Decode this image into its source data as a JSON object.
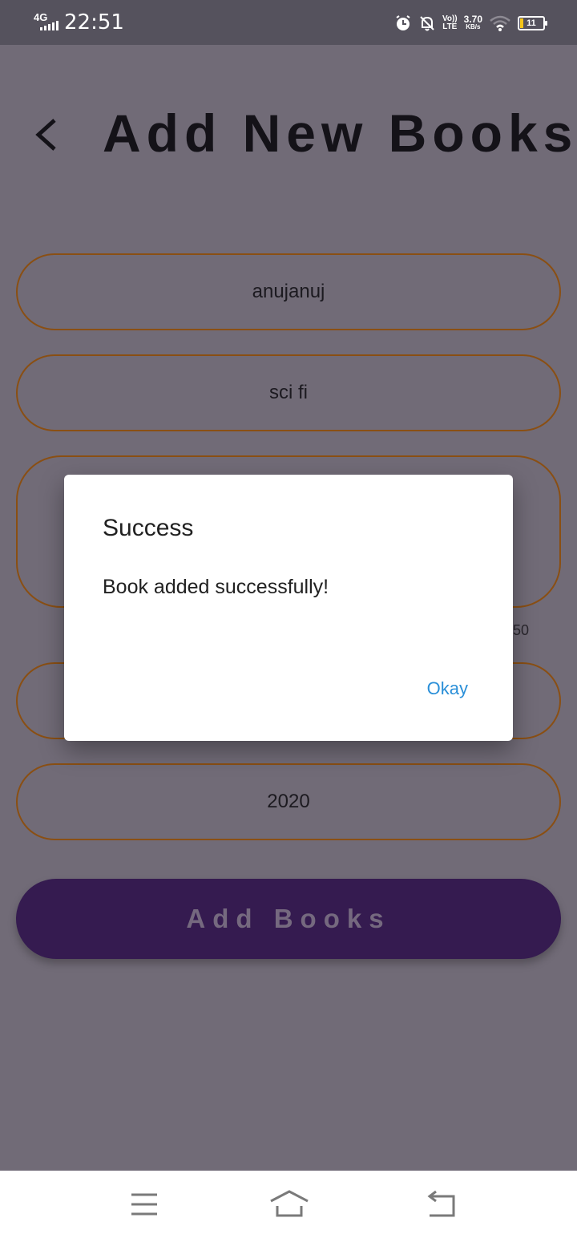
{
  "status_bar": {
    "network": "4G",
    "time": "22:51",
    "volte": "Vo))",
    "lte": "LTE",
    "speed_value": "3.70",
    "speed_unit": "KB/s",
    "battery": "11",
    "icons": [
      "signal-icon",
      "alarm-icon",
      "bell-off-icon",
      "wifi-icon",
      "battery-icon"
    ]
  },
  "header": {
    "title": "Add New Books",
    "back_icon": "chevron-left-icon"
  },
  "form": {
    "field1_value": "anujanuj",
    "field2_value": "sci fi",
    "field3_value": "",
    "counter_text": "50",
    "field4_value": "",
    "field5_value": "2020"
  },
  "add_button": {
    "label": "Add Books",
    "background": "#351b50"
  },
  "dialog": {
    "title": "Success",
    "message": "Book added successfully!",
    "okay_label": "Okay",
    "okay_color": "#2a8fd8"
  },
  "nav_bar": {
    "icons": [
      "menu-icon",
      "home-icon",
      "back-icon"
    ]
  },
  "colors": {
    "scrim": "#716b77",
    "field_border": "#8a4f13",
    "status_bar": "#55525d"
  }
}
